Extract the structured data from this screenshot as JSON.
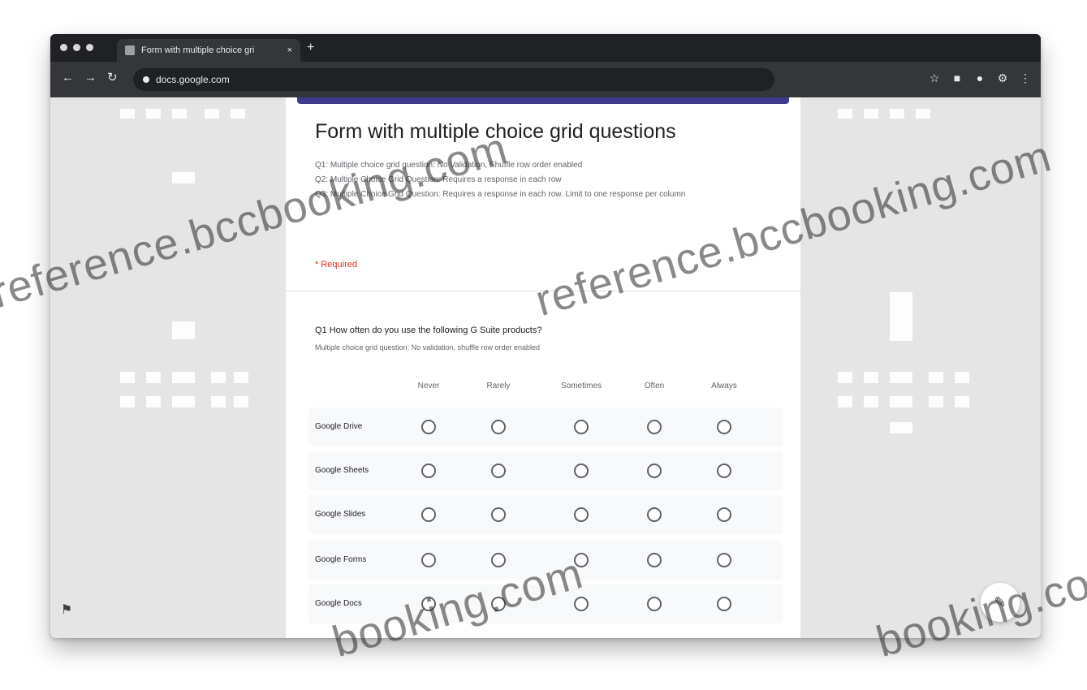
{
  "browser": {
    "tab_title": "Form with multiple choice gri",
    "tab_close": "×",
    "new_tab": "+",
    "url": "docs.google.com"
  },
  "form": {
    "title": "Form with multiple choice grid questions",
    "description_lines": [
      "Q1: Multiple choice grid question: No Validation, Shuffle row order enabled",
      "Q2: Multiple Choice Grid Question: Requires a response in each row",
      "Q3: Multiple Choice Grid Question: Requires a response in each row. Limit to one response per column"
    ],
    "required_note": "* Required",
    "question": {
      "title": "Q1 How often do you use the following G Suite products?",
      "subtitle": "Multiple choice grid question: No validation, shuffle row order enabled",
      "columns": [
        "Never",
        "Rarely",
        "Sometimes",
        "Often",
        "Always"
      ],
      "rows": [
        "Google Drive",
        "Google Sheets",
        "Google Slides",
        "Google Forms",
        "Google Docs"
      ]
    }
  },
  "watermarks": [
    "reference.bccbooking.com",
    "reference.bccbooking.com",
    "booking.com",
    "booking.com"
  ],
  "icons": {
    "fab_left": "feedback-icon",
    "fab_right": "edit-pencil-icon"
  }
}
